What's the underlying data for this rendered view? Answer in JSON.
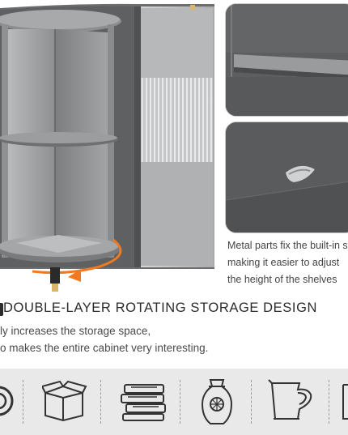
{
  "callout": {
    "caption_lines": [
      "Metal parts fix the built-in s",
      "making it easier to adjust",
      "the height of the shelves"
    ]
  },
  "feature": {
    "title": "DOUBLE-LAYER ROTATING STORAGE DESIGN",
    "description_lines": [
      "ly increases the storage space,",
      "o makes the entire cabinet very interesting."
    ]
  },
  "icons": [
    "plate-icon",
    "box-icon",
    "books-icon",
    "vase-icon",
    "pitcher-icon",
    "item-icon"
  ],
  "colors": {
    "cabinet_gray": "#8a8b8d",
    "rotation_arrow": "#f07a22",
    "strip_background": "#e9e9e9",
    "text": "#333333"
  }
}
